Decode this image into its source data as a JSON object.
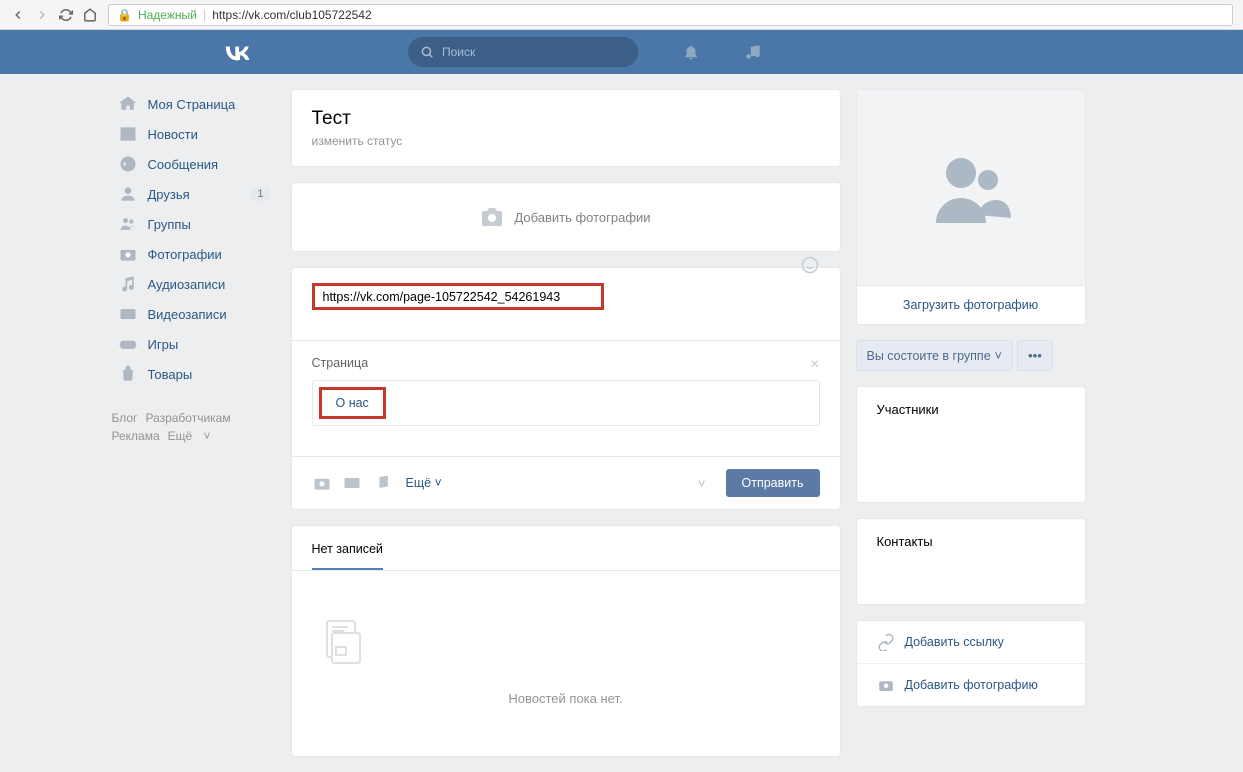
{
  "browser": {
    "secure_label": "Надежный",
    "url": "https://vk.com/club105722542"
  },
  "header": {
    "search_placeholder": "Поиск"
  },
  "nav": {
    "items": [
      {
        "label": "Моя Страница"
      },
      {
        "label": "Новости"
      },
      {
        "label": "Сообщения"
      },
      {
        "label": "Друзья",
        "count": "1"
      },
      {
        "label": "Группы"
      },
      {
        "label": "Фотографии"
      },
      {
        "label": "Аудиозаписи"
      },
      {
        "label": "Видеозаписи"
      },
      {
        "label": "Игры"
      },
      {
        "label": "Товары"
      }
    ],
    "footer": {
      "blog": "Блог",
      "dev": "Разработчикам",
      "ads": "Реклама",
      "more": "Ещё"
    }
  },
  "group": {
    "title": "Тест",
    "status": "изменить статус",
    "add_photos": "Добавить фотографии"
  },
  "post": {
    "input_value": "https://vk.com/page-105722542_54261943",
    "attach_label": "Страница",
    "attach_item": "О нас",
    "more": "Ещё",
    "send": "Отправить"
  },
  "feed": {
    "no_posts_tab": "Нет записей",
    "empty_text": "Новостей пока нет."
  },
  "sidebar": {
    "upload": "Загрузить фотографию",
    "member_btn": "Вы состоите в группе",
    "members_title": "Участники",
    "contacts_title": "Контакты",
    "add_link": "Добавить ссылку",
    "add_photo": "Добавить фотографию"
  }
}
